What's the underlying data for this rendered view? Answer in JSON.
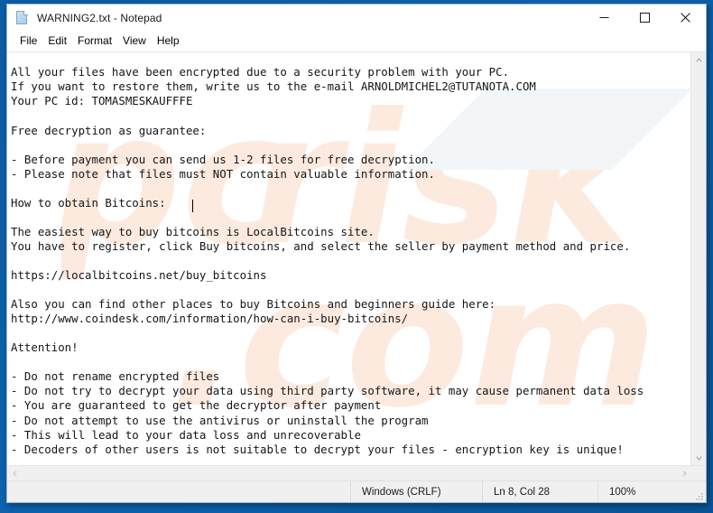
{
  "window": {
    "title": "WARNING2.txt - Notepad",
    "icon": "text-document-icon",
    "controls": {
      "minimize": "Minimize",
      "maximize": "Maximize",
      "close": "Close"
    }
  },
  "menu": {
    "items": [
      {
        "label": "File"
      },
      {
        "label": "Edit"
      },
      {
        "label": "Format"
      },
      {
        "label": "View"
      },
      {
        "label": "Help"
      }
    ]
  },
  "document": {
    "body": "All your files have been encrypted due to a security problem with your PC.\nIf you want to restore them, write us to the e-mail ARNOLDMICHEL2@TUTANOTA.COM\nYour PC id: TOMASMESKAUFFFE\n\nFree decryption as guarantee:\n\n- Before payment you can send us 1-2 files for free decryption.\n- Please note that files must NOT contain valuable information.\n\nHow to obtain Bitcoins:\n\nThe easiest way to buy bitcoins is LocalBitcoins site.\nYou have to register, click Buy bitcoins, and select the seller by payment method and price.\n\nhttps://localbitcoins.net/buy_bitcoins\n\nAlso you can find other places to buy Bitcoins and beginners guide here:\nhttp://www.coindesk.com/information/how-can-i-buy-bitcoins/\n\nAttention!\n\n- Do not rename encrypted files\n- Do not try to decrypt your data using third party software, it may cause permanent data loss\n- You are guaranteed to get the decryptor after payment\n- Do not attempt to use the antivirus or uninstall the program\n- This will lead to your data loss and unrecoverable\n- Decoders of other users is not suitable to decrypt your files - encryption key is unique!",
    "email": "ARNOLDMICHEL2@TUTANOTA.COM",
    "pc_id": "TOMASMESKAUFFFE",
    "links": [
      "https://localbitcoins.net/buy_bitcoins",
      "http://www.coindesk.com/information/how-can-i-buy-bitcoins/"
    ],
    "watermark": "pcrisk.com"
  },
  "status_bar": {
    "encoding": "Windows (CRLF)",
    "position": "Ln 8, Col 28",
    "zoom": "100%"
  },
  "scrollbars": {
    "vertical_up": "scroll-up",
    "vertical_down": "scroll-down",
    "horizontal_left": "scroll-left",
    "horizontal_right": "scroll-right"
  },
  "colors": {
    "desktop": "#0b5fa5",
    "window_bg": "#ffffff",
    "status_bg": "#f0f0f0",
    "text": "#151515",
    "watermark": "#fdeadf"
  }
}
